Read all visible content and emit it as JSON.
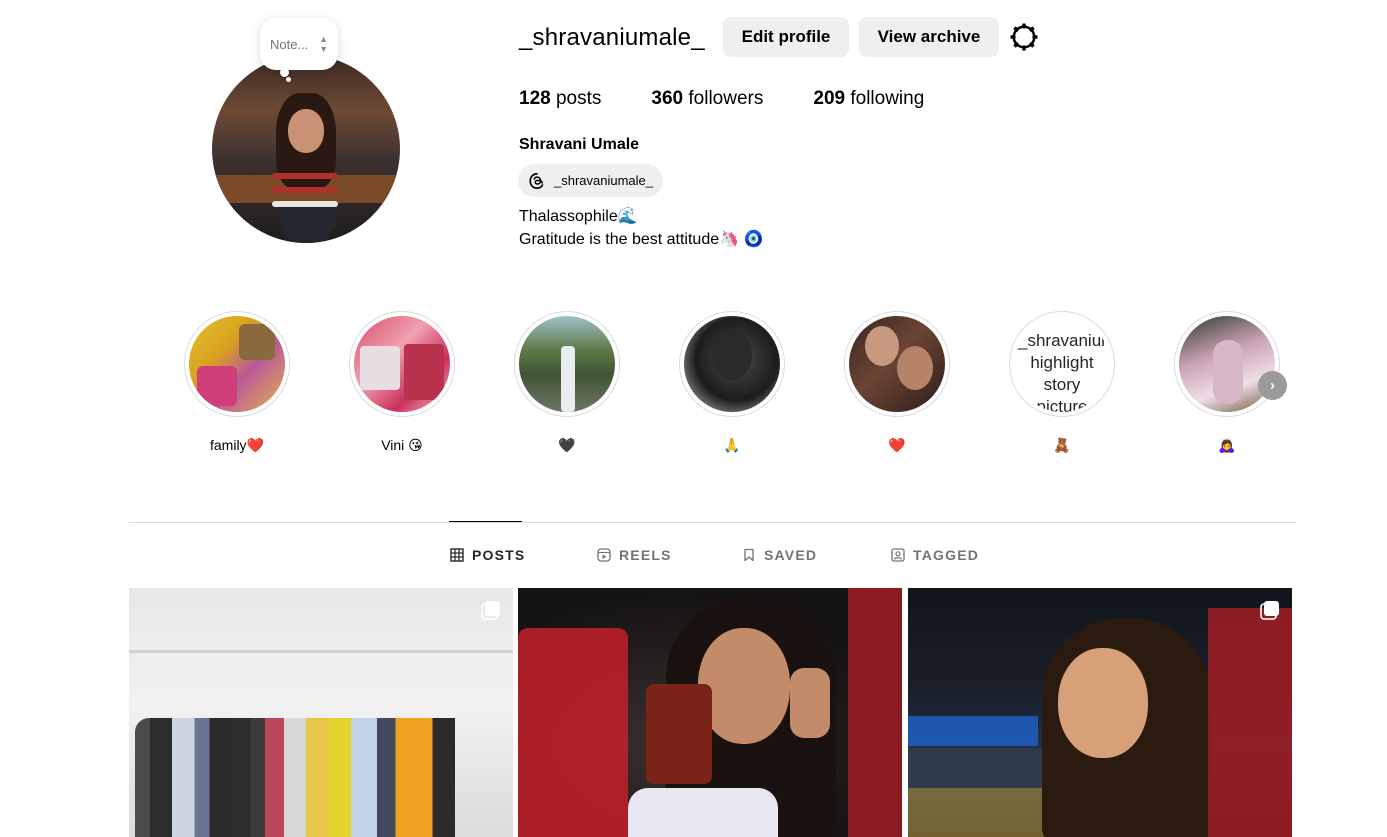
{
  "profile": {
    "username": "_shravaniumale_",
    "edit_button": "Edit profile",
    "archive_button": "View archive",
    "note_placeholder": "Note...",
    "stats": {
      "posts_count": "128",
      "posts_label": "posts",
      "followers_count": "360",
      "followers_label": "followers",
      "following_count": "209",
      "following_label": "following"
    },
    "full_name": "Shravani Umale",
    "threads_handle": "_shravaniumale_",
    "bio_line1": "Thalassophile🌊",
    "bio_line2": "Gratitude is the best attitude🦄 🧿"
  },
  "highlights": [
    {
      "label": "family❤️"
    },
    {
      "label": "Vini 😘"
    },
    {
      "label": "🖤"
    },
    {
      "label": "🙏"
    },
    {
      "label": "❤️"
    },
    {
      "label": "🧸",
      "broken_alt": "_shravaniumale_'s highlight story picture"
    },
    {
      "label": "🙇‍♀️"
    }
  ],
  "tabs": [
    {
      "label": "POSTS",
      "icon": "grid-icon",
      "active": true
    },
    {
      "label": "REELS",
      "icon": "reels-icon",
      "active": false
    },
    {
      "label": "SAVED",
      "icon": "bookmark-icon",
      "active": false
    },
    {
      "label": "TAGGED",
      "icon": "tagged-icon",
      "active": false
    }
  ],
  "colors": {
    "button_bg": "#efefef",
    "divider": "#dbdbdb",
    "muted_text": "#737373"
  }
}
